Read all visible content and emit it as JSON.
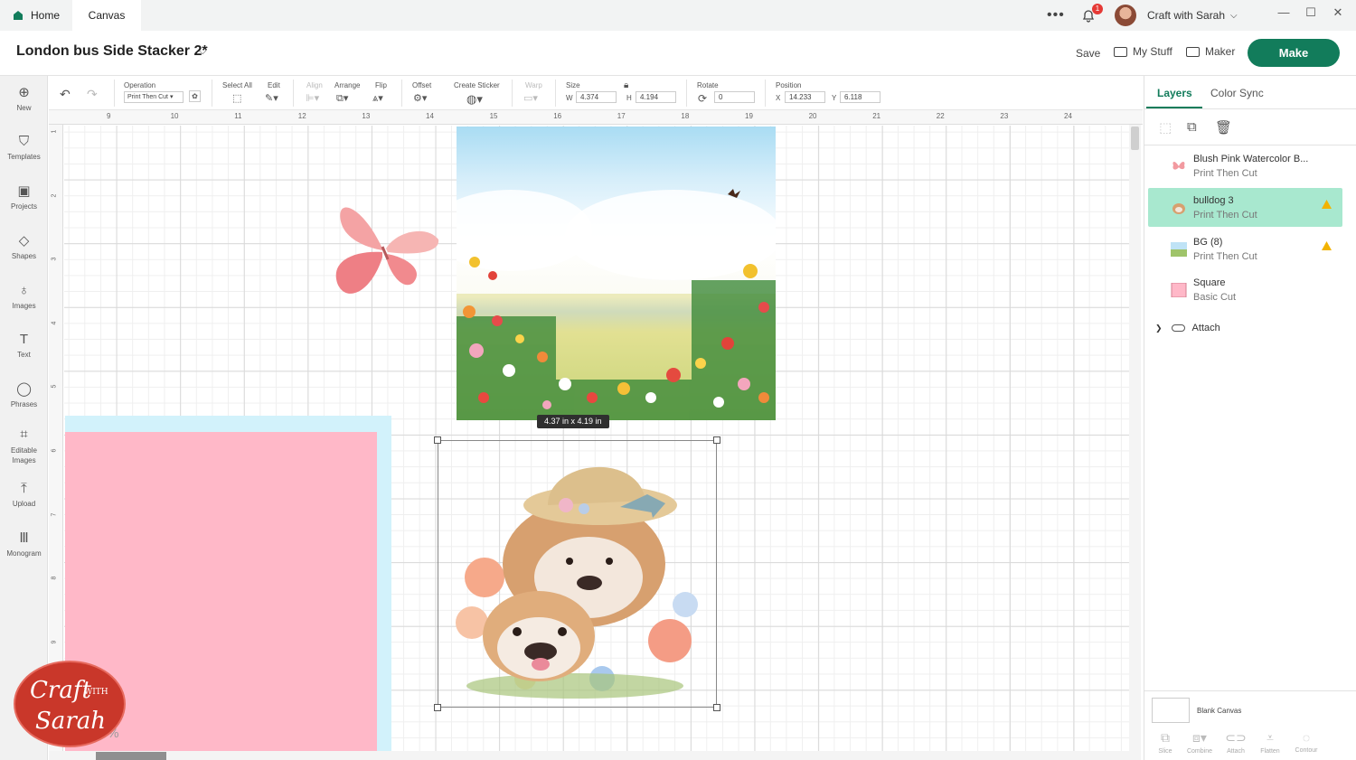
{
  "topbar": {
    "tab_home": "Home",
    "tab_canvas": "Canvas",
    "more": "•••",
    "notification_count": "1",
    "account_name": "Craft with Sarah",
    "minimize": "—",
    "maximize": "☐",
    "close": "✕"
  },
  "header": {
    "project_title": "London bus Side Stacker 2*",
    "save": "Save",
    "my_stuff": "My Stuff",
    "maker": "Maker",
    "make": "Make"
  },
  "sidebar": {
    "items": [
      {
        "label": "New",
        "icon": "plus-circle-icon"
      },
      {
        "label": "Templates",
        "icon": "shirt-icon"
      },
      {
        "label": "Projects",
        "icon": "clipboard-icon"
      },
      {
        "label": "Shapes",
        "icon": "shapes-icon"
      },
      {
        "label": "Images",
        "icon": "bulb-icon"
      },
      {
        "label": "Text",
        "icon": "text-icon"
      },
      {
        "label": "Phrases",
        "icon": "speech-bubble-icon"
      },
      {
        "label": "Editable Images",
        "icon": "editable-image-icon"
      },
      {
        "label": "Upload",
        "icon": "upload-icon"
      },
      {
        "label": "Monogram",
        "icon": "monogram-icon"
      }
    ]
  },
  "toolbar": {
    "operation_label": "Operation",
    "operation_value": "Print Then Cut",
    "select_all": "Select All",
    "edit": "Edit",
    "align": "Align",
    "arrange": "Arrange",
    "flip": "Flip",
    "offset": "Offset",
    "create_sticker": "Create Sticker",
    "warp": "Warp",
    "size_label": "Size",
    "w_label": "W",
    "w_value": "4.374",
    "h_label": "H",
    "h_value": "4.194",
    "rotate_label": "Rotate",
    "rotate_value": "0",
    "position_label": "Position",
    "x_label": "X",
    "x_value": "14.233",
    "y_label": "Y",
    "y_value": "6.118"
  },
  "canvas": {
    "ruler_top": [
      "9",
      "10",
      "11",
      "12",
      "13",
      "14",
      "15",
      "16",
      "17",
      "18",
      "19",
      "20",
      "21",
      "22",
      "23",
      "24"
    ],
    "ruler_left": [
      "1",
      "2",
      "3",
      "4",
      "5",
      "6",
      "7",
      "8",
      "9"
    ],
    "dimensions_tooltip": "4.37 in x 4.19 in",
    "zoom_fragment": "%",
    "logo_line1": "Craft",
    "logo_with": "WITH",
    "logo_line2": "Sarah"
  },
  "right_panel": {
    "tab_layers": "Layers",
    "tab_color_sync": "Color Sync",
    "layers": [
      {
        "name": "Blush Pink Watercolor B...",
        "operation": "Print Then Cut",
        "selected": false,
        "warning": false
      },
      {
        "name": "bulldog 3",
        "operation": "Print Then Cut",
        "selected": true,
        "warning": true
      },
      {
        "name": "BG (8)",
        "operation": "Print Then Cut",
        "selected": false,
        "warning": true
      },
      {
        "name": "Square",
        "operation": "Basic Cut",
        "selected": false,
        "warning": false
      }
    ],
    "attach_label": "Attach",
    "blank_canvas": "Blank Canvas",
    "bottom_tools": [
      "Slice",
      "Combine",
      "Attach",
      "Flatten",
      "Contour"
    ]
  },
  "colors": {
    "brand_green": "#127c5b",
    "selected_layer": "#a8e8cf",
    "pink_square": "#ffb8c8",
    "bg_square": "#d2f2fb",
    "logo_red": "#c9372a"
  }
}
